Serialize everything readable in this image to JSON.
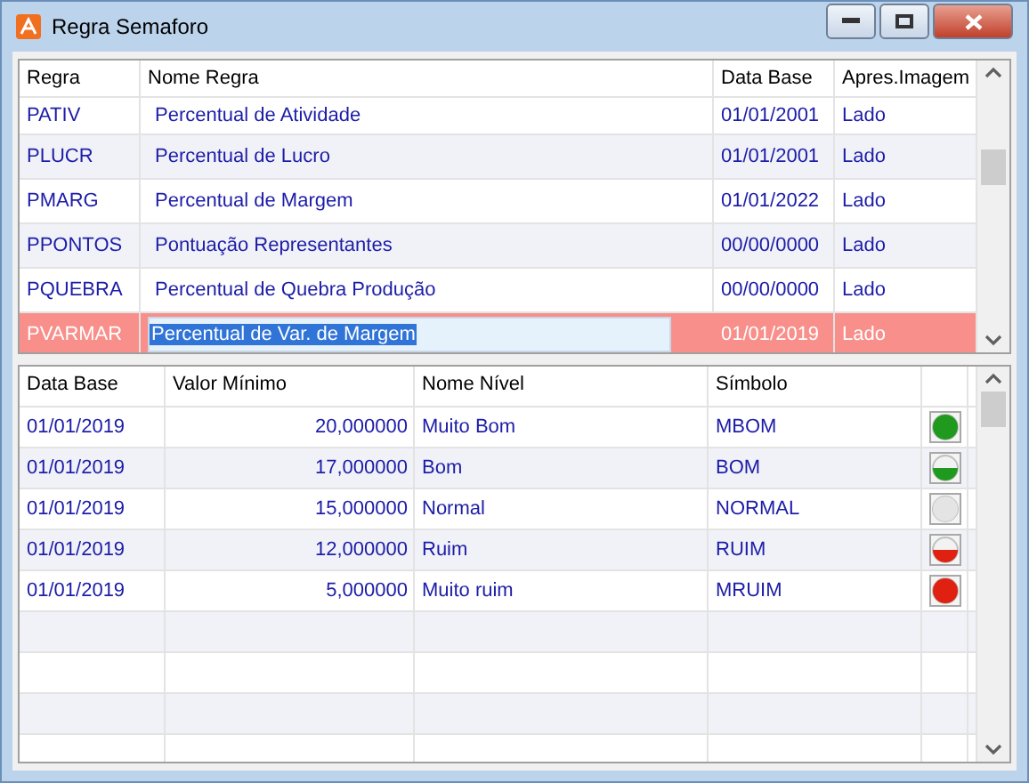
{
  "window": {
    "title": "Regra Semaforo"
  },
  "rules": {
    "columns": [
      "Regra",
      "Nome Regra",
      "Data Base",
      "Apres.Imagem"
    ],
    "rows": [
      {
        "code": "PATIV",
        "name": "Percentual de Atividade",
        "date": "01/01/2001",
        "display": "Lado",
        "selected": false,
        "editing": false
      },
      {
        "code": "PLUCR",
        "name": "Percentual de Lucro",
        "date": "01/01/2001",
        "display": "Lado",
        "selected": false,
        "editing": false
      },
      {
        "code": "PMARG",
        "name": "Percentual de Margem",
        "date": "01/01/2022",
        "display": "Lado",
        "selected": false,
        "editing": false
      },
      {
        "code": "PPONTOS",
        "name": "Pontuação Representantes",
        "date": "00/00/0000",
        "display": "Lado",
        "selected": false,
        "editing": false
      },
      {
        "code": "PQUEBRA",
        "name": "Percentual de Quebra Produção",
        "date": "00/00/0000",
        "display": "Lado",
        "selected": false,
        "editing": false
      },
      {
        "code": "PVARMAR",
        "name": "Percentual de Var. de Margem",
        "date": "01/01/2019",
        "display": "Lado",
        "selected": true,
        "editing": true
      }
    ]
  },
  "levels": {
    "columns": [
      "Data Base",
      "Valor Mínimo",
      "Nome Nível",
      "Símbolo"
    ],
    "rows": [
      {
        "date": "01/01/2019",
        "min": "20,000000",
        "name": "Muito Bom",
        "symbol": "MBOM",
        "light": {
          "kind": "full",
          "color": "#1f9a1f"
        }
      },
      {
        "date": "01/01/2019",
        "min": "17,000000",
        "name": "Bom",
        "symbol": "BOM",
        "light": {
          "kind": "half",
          "color": "#1f9a1f"
        }
      },
      {
        "date": "01/01/2019",
        "min": "15,000000",
        "name": "Normal",
        "symbol": "NORMAL",
        "light": {
          "kind": "full",
          "color": "#e4e4e4"
        }
      },
      {
        "date": "01/01/2019",
        "min": "12,000000",
        "name": "Ruim",
        "symbol": "RUIM",
        "light": {
          "kind": "half",
          "color": "#e02010"
        }
      },
      {
        "date": "01/01/2019",
        "min": "5,000000",
        "name": "Muito ruim",
        "symbol": "MRUIM",
        "light": {
          "kind": "full",
          "color": "#e02010"
        }
      }
    ]
  }
}
